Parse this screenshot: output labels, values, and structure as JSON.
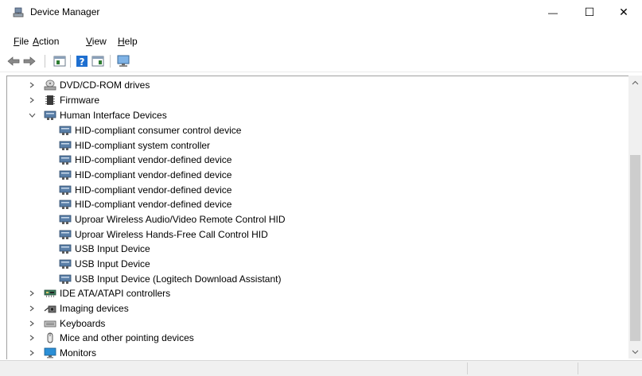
{
  "window": {
    "title": "Device Manager",
    "controls": {
      "minimize": "—",
      "maximize": "☐",
      "close": "✕"
    }
  },
  "menu": [
    {
      "key": "F",
      "rest": "ile"
    },
    {
      "key": "A",
      "rest": "ction"
    },
    {
      "key": "V",
      "rest": "iew"
    },
    {
      "key": "H",
      "rest": "elp"
    }
  ],
  "toolbar": {
    "icons": [
      "back-arrow-icon",
      "forward-arrow-icon",
      "properties-icon",
      "help-icon",
      "view-icon",
      "scan-hardware-icon"
    ]
  },
  "tree": {
    "categories": [
      {
        "label": "DVD/CD-ROM drives",
        "expanded": false
      },
      {
        "label": "Firmware",
        "expanded": false
      },
      {
        "label": "Human Interface Devices",
        "expanded": true
      },
      {
        "label": "IDE ATA/ATAPI controllers",
        "expanded": false
      },
      {
        "label": "Imaging devices",
        "expanded": false
      },
      {
        "label": "Keyboards",
        "expanded": false
      },
      {
        "label": "Mice and other pointing devices",
        "expanded": false
      },
      {
        "label": "Monitors",
        "expanded": false
      }
    ],
    "hid_devices": [
      "HID-compliant consumer control device",
      "HID-compliant system controller",
      "HID-compliant vendor-defined device",
      "HID-compliant vendor-defined device",
      "HID-compliant vendor-defined device",
      "HID-compliant vendor-defined device",
      "Uproar Wireless Audio/Video Remote Control HID",
      "Uproar Wireless Hands-Free Call Control HID",
      "USB Input Device",
      "USB Input Device",
      "USB Input Device (Logitech Download Assistant)"
    ]
  },
  "colors": {
    "hid_icon": "#5a7fa8",
    "monitor_blue": "#2b8fd6",
    "help_blue": "#1e6fd0"
  }
}
